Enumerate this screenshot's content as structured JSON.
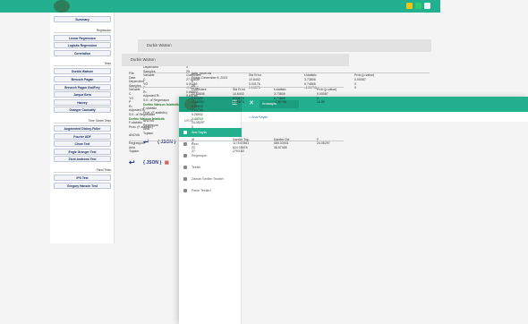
{
  "back": {
    "sidebar": {
      "buttons_top": [
        "Summary"
      ],
      "head_regression": "Regression",
      "buttons_regression": [
        "Linear Regression",
        "Logistic Regression",
        "Correlation"
      ],
      "head_tests": "Tests",
      "buttons_tests": [
        "Durbin Watson",
        "Breusch Pagan",
        "Breusch Pagan GodFrey",
        "Jarque Bera",
        "Harvey",
        "Granger Causality"
      ],
      "head_timeseries": "Time Series Tests",
      "buttons_timeseries": [
        "Augmented Dickey-Fuller",
        "Fourier ADF",
        "Chow Test",
        "Engle Granger Test",
        "Zivot Andrews Test"
      ],
      "head_panel": "Panel Tests",
      "buttons_panel": [
        "IPS Test",
        "Gregory Hansen Test"
      ]
    },
    "title": "Durbin Watson",
    "rows": [
      {
        "a": "File",
        "b": "data_excel.xls"
      },
      {
        "a": "Date",
        "b": "Friday, December 8, 2023"
      },
      {
        "a": "Dependent",
        "b": "0"
      },
      {
        "a": "Samples",
        "b": "25"
      },
      {
        "a": "Variable",
        "b": "Coefficient",
        "c": "Std Error",
        "d": "t-statistic",
        "e": "Prob (p-value)"
      },
      {
        "a": "C",
        "b": "27.53606",
        "c": "10.6402",
        "d": "3.73806",
        "e": "0.00087"
      },
      {
        "a": "YO",
        "b": "0.01189",
        "c": "0.00176",
        "d": "6.74865",
        "e": "0"
      },
      {
        "a": "P",
        "b": "-0.68262",
        "c": "0.15875",
        "d": "-4.30798",
        "e": "0"
      },
      {
        "a": "R²",
        "b": "0.66803"
      },
      {
        "a": "Adjusted R²",
        "b": "0.63785"
      },
      {
        "a": "S.E. of Regression",
        "b": "5.28902"
      },
      {
        "a": "Durbin Watson İstatistik",
        "b": "2.44714"
      },
      {
        "a": "F-statistic",
        "b": "24.05297"
      },
      {
        "a": "Prob. (F-statistic)",
        "b": "0"
      }
    ],
    "anova_label": "ANOVA",
    "anova": [
      "Regresyon",
      "Artık",
      "Toplam"
    ],
    "json_label": "JSON"
  },
  "front": {
    "tab_label": "Anasayfa",
    "menu_label": "MENU",
    "nav": [
      {
        "label": "Ana Sayfa",
        "active": true
      },
      {
        "label": "Özet",
        "active": false
      },
      {
        "label": "Regresyon",
        "active": false
      },
      {
        "label": "Testler",
        "active": false
      },
      {
        "label": "Zaman Serileri Testleri",
        "active": false
      },
      {
        "label": "Panel Testleri",
        "active": false
      }
    ],
    "breadcrumb": "Ana Sayfa",
    "title": "Durbin Watson",
    "rows": [
      {
        "a": "File",
        "b": "data_excel.xls"
      },
      {
        "a": "Date",
        "b": "Friday, December 8, 2023"
      },
      {
        "a": "Dependent",
        "b": "0"
      },
      {
        "a": "Samples",
        "b": "25"
      },
      {
        "a": "Variable",
        "b": "Coefficient",
        "c": "Std Error",
        "d": "t-statistic",
        "e": "Prob (p-value)"
      },
      {
        "a": "C",
        "b": "27.53606",
        "c": "10.6402",
        "d": "3.73806",
        "e": "0.00087"
      },
      {
        "a": "YO",
        "b": "0.01189",
        "c": "0.00176",
        "d": "6.74865",
        "e": "0"
      },
      {
        "a": "P",
        "b": "-0.68262",
        "c": "0.15875",
        "d": "-4.30798",
        "e": "16.85"
      },
      {
        "a": "R²",
        "b": "0.66803"
      },
      {
        "a": "Adjusted R²",
        "b": "0.63785"
      },
      {
        "a": "S.E. of Regression",
        "b": "5.28902"
      },
      {
        "a": "Durbin Watson İstatistik",
        "b": "2.44714"
      },
      {
        "a": "F-statistic",
        "b": "24.05297"
      },
      {
        "a": "Prob. (F-statistic)",
        "b": "0"
      }
    ],
    "anova_label": "ANOVA",
    "anova_header": [
      "",
      "df",
      "Kareler Top.",
      "Kareler Ort.",
      "F"
    ],
    "anova": [
      [
        "Regresyon",
        "2",
        "1178.67861",
        "589.33931",
        "24.05297"
      ],
      [
        "Artık",
        "22",
        "624.05676",
        "36.57455",
        ""
      ],
      [
        "Toplam",
        "27",
        "2793.83",
        "",
        ""
      ]
    ],
    "json_label": "JSON"
  }
}
